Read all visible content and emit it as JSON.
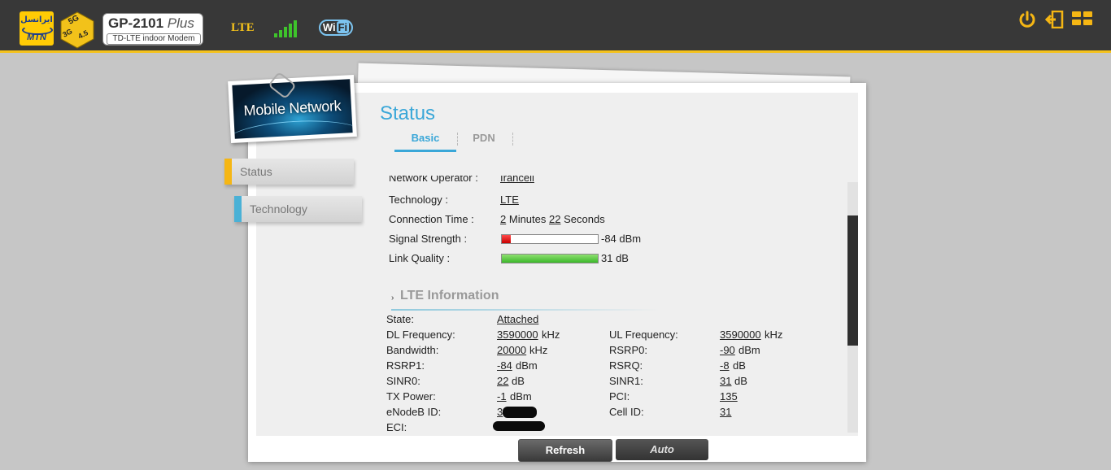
{
  "header": {
    "logo_fa": "ایرانسل",
    "logo_en": "MTN",
    "badge_5g": "5G",
    "badge_3g": "3G",
    "badge_45": "4.5",
    "model": "GP-2101",
    "model_suffix": "Plus",
    "model_subtitle": "TD-LTE indoor Modem",
    "network_type": "LTE",
    "wifi_label": "Wi",
    "wifi_label_b": "Fi",
    "accent_color": "#f5c21b",
    "icons": [
      "power-icon",
      "logout-icon",
      "grid-menu-icon"
    ]
  },
  "banner": {
    "title": "Mobile Network"
  },
  "sidebar": {
    "items": [
      {
        "label": "Status",
        "active": true
      },
      {
        "label": "Technology",
        "active": false
      }
    ]
  },
  "page": {
    "title": "Status"
  },
  "tabs": [
    {
      "label": "Basic",
      "active": true
    },
    {
      "label": "PDN",
      "active": false
    }
  ],
  "basic": {
    "network_operator_label": "Network Operator :",
    "network_operator_value": "Irancell",
    "technology_label": "Technology :",
    "technology_value": "LTE",
    "connection_time_label": "Connection Time :",
    "connection_minutes": "2",
    "connection_minutes_unit": "Minutes",
    "connection_seconds": "22",
    "connection_seconds_unit": "Seconds",
    "signal_strength_label": "Signal Strength :",
    "signal_strength_value": "-84 dBm",
    "signal_strength_fraction": 0.09,
    "link_quality_label": "Link Quality :",
    "link_quality_value": "31 dB",
    "link_quality_fraction": 1.0
  },
  "lte": {
    "section_title": "LTE Information",
    "section_marker": "›",
    "rows": [
      {
        "l1": "State:",
        "v1": "Attached",
        "u1": "",
        "l2": "",
        "v2": "",
        "u2": ""
      },
      {
        "l1": "DL Frequency:",
        "v1": "3590000",
        "u1": "kHz",
        "l2": "UL Frequency:",
        "v2": "3590000",
        "u2": "kHz"
      },
      {
        "l1": "Bandwidth:",
        "v1": "20000",
        "u1": "kHz",
        "l2": "RSRP0:",
        "v2": "-90",
        "u2": "dBm"
      },
      {
        "l1": "RSRP1:",
        "v1": "-84",
        "u1": "dBm",
        "l2": "RSRQ:",
        "v2": "-8",
        "u2": "dB"
      },
      {
        "l1": "SINR0:",
        "v1": "22",
        "u1": "dB",
        "l2": "SINR1:",
        "v2": "31",
        "u2": "dB"
      },
      {
        "l1": "TX Power:",
        "v1": "-1",
        "u1": "dBm",
        "l2": "PCI:",
        "v2": "135",
        "u2": ""
      },
      {
        "l1": "eNodeB ID:",
        "v1": "3",
        "u1": "",
        "l2": "Cell ID:",
        "v2": "31",
        "u2": ""
      },
      {
        "l1": "ECI:",
        "v1": "",
        "u1": "",
        "l2": "",
        "v2": "",
        "u2": ""
      }
    ]
  },
  "buttons": {
    "refresh": "Refresh",
    "auto": "Auto"
  }
}
